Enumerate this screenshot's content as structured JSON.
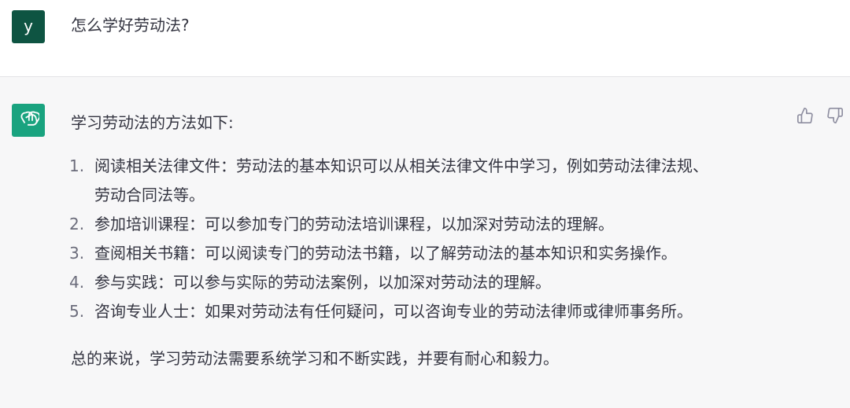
{
  "user": {
    "avatar_letter": "y",
    "message": "怎么学好劳动法?"
  },
  "assistant": {
    "intro": "学习劳动法的方法如下:",
    "steps": [
      {
        "num": "1.",
        "line1": "阅读相关法律文件：劳动法的基本知识可以从相关法律文件中学习，例如劳动法律法规、",
        "line2": "劳动合同法等。"
      },
      {
        "num": "2.",
        "line1": "参加培训课程：可以参加专门的劳动法培训课程，以加深对劳动法的理解。"
      },
      {
        "num": "3.",
        "line1": "查阅相关书籍：可以阅读专门的劳动法书籍，以了解劳动法的基本知识和实务操作。"
      },
      {
        "num": "4.",
        "line1": "参与实践：可以参与实际的劳动法案例，以加深对劳动法的理解。"
      },
      {
        "num": "5.",
        "line1": "咨询专业人士：如果对劳动法有任何疑问，可以咨询专业的劳动法律师或律师事务所。"
      }
    ],
    "summary": "总的来说，学习劳动法需要系统学习和不断实践，并要有耐心和毅力。"
  },
  "icons": {
    "bot_avatar": "openai-logo-icon",
    "thumbs_up": "thumbs-up-icon",
    "thumbs_down": "thumbs-down-icon"
  },
  "colors": {
    "user_avatar_bg": "#0e5442",
    "bot_avatar_bg": "#19a37f",
    "assistant_bg": "#f7f7f8",
    "text": "#343541"
  }
}
